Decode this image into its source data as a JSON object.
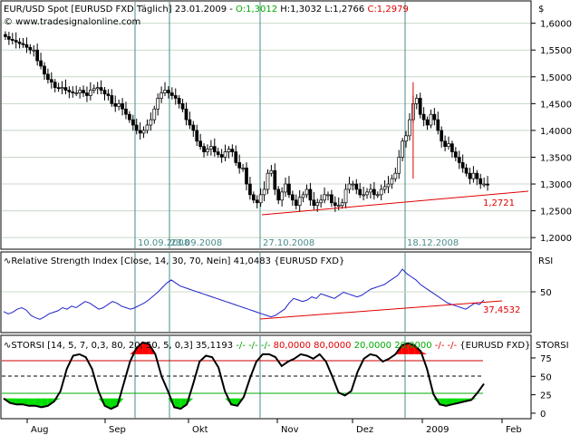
{
  "header": {
    "currency_symbol": "$",
    "title_prefix": "EUR/USD Spot [EURUSD FXD  Täglich] 23.01.2009 - ",
    "o_label": "O:1,3012",
    "h_label": " H:1,3032",
    "l_label": " L:1,2766",
    "c_label": " C:1,2979",
    "watermark": "© www.tradesignalonline.com"
  },
  "colors": {
    "background": "#ffffff",
    "grid": "#c8d8c8",
    "frame": "#000000",
    "candle_up": "#ffffff",
    "candle_down": "#000000",
    "wick": "#000000",
    "red_line": "#e00000",
    "blue_rsi": "#2222cc",
    "teal_vline": "#4a8c8c",
    "title_green": "#00aa00",
    "title_red": "#e00000",
    "title_blue": "#2222cc",
    "stor_fill_red": "#ff0000",
    "stor_fill_green": "#00dd00",
    "stor_line": "#000000",
    "upper_red_hline": "#cc0000",
    "lower_green_hline": "#00aa00",
    "date_label": "#4a8c8c"
  },
  "chart_data": [
    {
      "type": "candlestick",
      "title": "EUR/USD Spot [EURUSD FXD  Täglich] 23.01.2009 - O:1,3012 H:1,3032 L:1,2766 C:1,2979",
      "x_range_days": [
        0,
        190
      ],
      "ylim": [
        1.18,
        1.64
      ],
      "y_ticks": [
        "1,6000",
        "1,5500",
        "1,5000",
        "1,4500",
        "1,4000",
        "1,3500",
        "1,3000",
        "1,2500",
        "1,2000"
      ],
      "y_tick_values": [
        1.6,
        1.55,
        1.5,
        1.45,
        1.4,
        1.35,
        1.3,
        1.25,
        1.2
      ],
      "closes": [
        1.575,
        1.57,
        1.568,
        1.565,
        1.562,
        1.56,
        1.555,
        1.55,
        1.55,
        1.53,
        1.52,
        1.505,
        1.495,
        1.49,
        1.48,
        1.478,
        1.48,
        1.475,
        1.472,
        1.47,
        1.47,
        1.475,
        1.47,
        1.465,
        1.475,
        1.478,
        1.48,
        1.475,
        1.468,
        1.465,
        1.45,
        1.445,
        1.45,
        1.44,
        1.43,
        1.42,
        1.41,
        1.4,
        1.395,
        1.4,
        1.41,
        1.42,
        1.44,
        1.46,
        1.47,
        1.475,
        1.47,
        1.465,
        1.46,
        1.45,
        1.44,
        1.42,
        1.41,
        1.4,
        1.38,
        1.37,
        1.36,
        1.365,
        1.37,
        1.36,
        1.355,
        1.35,
        1.36,
        1.365,
        1.36,
        1.34,
        1.33,
        1.33,
        1.3,
        1.28,
        1.27,
        1.265,
        1.28,
        1.29,
        1.32,
        1.325,
        1.29,
        1.27,
        1.285,
        1.3,
        1.28,
        1.27,
        1.26,
        1.275,
        1.28,
        1.29,
        1.27,
        1.26,
        1.265,
        1.27,
        1.28,
        1.28,
        1.265,
        1.26,
        1.26,
        1.265,
        1.29,
        1.3,
        1.3,
        1.29,
        1.28,
        1.28,
        1.285,
        1.29,
        1.28,
        1.28,
        1.29,
        1.295,
        1.3,
        1.31,
        1.32,
        1.35,
        1.38,
        1.39,
        1.42,
        1.45,
        1.46,
        1.43,
        1.42,
        1.41,
        1.43,
        1.42,
        1.4,
        1.38,
        1.37,
        1.375,
        1.36,
        1.35,
        1.34,
        1.33,
        1.32,
        1.31,
        1.32,
        1.31,
        1.3,
        1.3,
        1.298
      ],
      "trendline": {
        "start": [
          1.2721,
          "27.10.2008"
        ],
        "end": [
          1.2721,
          "Jan 2009"
        ],
        "label": "1,2721"
      },
      "annotations": [
        "10.09.2008",
        "23.09.2008",
        "27.10.2008",
        "18.12.2008"
      ],
      "x_labels": [
        "Aug",
        "Sep",
        "Okt",
        "Nov",
        "Dez",
        "2009",
        "Feb"
      ]
    },
    {
      "type": "line",
      "title": "Relative Strength Index [Close, 14, 30, 70, Nein] 41,0483 {EURUSD FXD}",
      "series": [
        {
          "name": "RSI",
          "values": [
            25,
            22,
            24,
            28,
            30,
            27,
            20,
            17,
            15,
            18,
            22,
            24,
            26,
            30,
            28,
            32,
            30,
            34,
            38,
            36,
            32,
            28,
            30,
            34,
            38,
            36,
            32,
            30,
            28,
            30,
            33,
            36,
            40,
            45,
            50,
            56,
            62,
            66,
            62,
            58,
            56,
            54,
            52,
            50,
            48,
            46,
            44,
            42,
            40,
            38,
            36,
            34,
            32,
            30,
            28,
            26,
            24,
            22,
            20,
            18,
            20,
            24,
            28,
            36,
            42,
            40,
            38,
            40,
            44,
            42,
            48,
            46,
            44,
            42,
            46,
            50,
            48,
            46,
            44,
            46,
            50,
            54,
            56,
            58,
            60,
            64,
            68,
            72,
            80,
            74,
            70,
            66,
            60,
            56,
            52,
            48,
            44,
            40,
            36,
            34,
            32,
            30,
            28,
            32,
            36,
            34,
            40
          ]
        }
      ],
      "label_50": "50",
      "trendline_label": "37,4532",
      "right_label": "RSI",
      "ylim": [
        0,
        100
      ]
    },
    {
      "type": "line",
      "title": "STORSI [14, 5, 7, 0,3, 80, 20, 50, 5, 0,3] 35,1193",
      "title_parts": {
        "main": "STORSI [14, 5, 7, 0,3, 80, 20, 50, 5, 0,3] 35,1193 ",
        "dashes1": "-/- -/- -/- ",
        "red_vals": "80,0000 80,0000 ",
        "green_vals": "20,0000 20,0000 ",
        "dashes2": "-/- -/- ",
        "symbol": "{EURUSD FXD}"
      },
      "series": [
        {
          "name": "STORSI",
          "values": [
            20,
            14,
            12,
            12,
            10,
            10,
            8,
            10,
            16,
            30,
            60,
            78,
            80,
            76,
            60,
            30,
            10,
            6,
            10,
            40,
            70,
            88,
            96,
            94,
            80,
            50,
            30,
            8,
            6,
            12,
            40,
            70,
            78,
            76,
            62,
            30,
            12,
            10,
            22,
            48,
            70,
            80,
            80,
            76,
            64,
            70,
            74,
            80,
            78,
            74,
            80,
            70,
            50,
            28,
            24,
            30,
            56,
            74,
            80,
            78,
            70,
            74,
            80,
            92,
            95,
            92,
            84,
            60,
            26,
            12,
            10,
            12,
            14,
            16,
            18,
            28,
            40
          ]
        }
      ],
      "y_ticks": [
        "75",
        "50",
        "25",
        "0"
      ],
      "upper": 80,
      "lower": 20,
      "mid": 50,
      "right_label": "STORSI",
      "ylim": [
        -5,
        102
      ]
    }
  ]
}
